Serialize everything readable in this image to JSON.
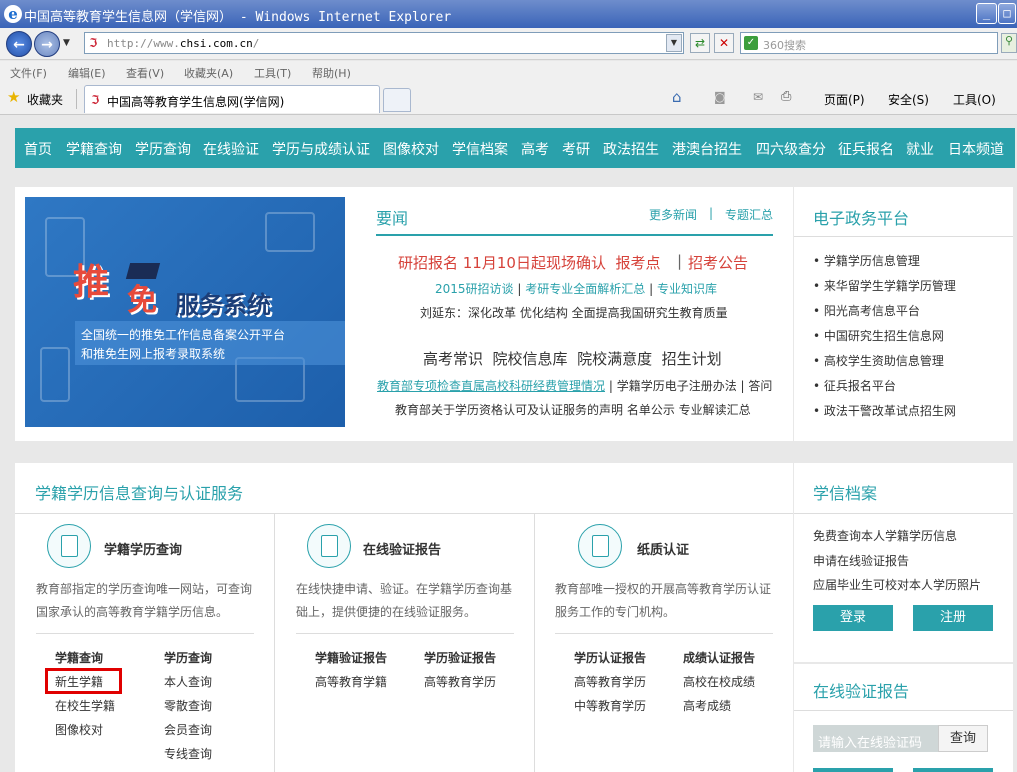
{
  "browser": {
    "title": "中国高等教育学生信息网（学信网） - Windows Internet Explorer",
    "url_prefix": "http://www.",
    "url_domain": "chsi.com.cn",
    "url_suffix": "/",
    "search_placeholder": "360搜索",
    "menu": [
      "文件(F)",
      "编辑(E)",
      "查看(V)",
      "收藏夹(A)",
      "工具(T)",
      "帮助(H)"
    ],
    "favorites_label": "收藏夹",
    "tab_title": "中国高等教育学生信息网(学信网)",
    "cmd_page": "页面(P)",
    "cmd_safety": "安全(S)",
    "cmd_tools": "工具(O)"
  },
  "nav": [
    "首页",
    "学籍查询",
    "学历查询",
    "在线验证",
    "学历与成绩认证",
    "图像校对",
    "学信档案",
    "高考",
    "考研",
    "政法招生",
    "港澳台招生",
    "四六级查分",
    "征兵报名",
    "就业",
    "日本频道"
  ],
  "banner": {
    "title_a": "推",
    "title_b": "免",
    "title_c": "服务系统",
    "line1": "全国统一的推免工作信息备案公开平台",
    "line2": "和推免生网上报考录取系统"
  },
  "news": {
    "title": "要闻",
    "more": "更多新闻",
    "sep": "|",
    "topics": "专题汇总",
    "headline": "研招报名 11月10日起现场确认  报考点",
    "headline_sep": "|",
    "headline_b": "招考公告",
    "row2": [
      "2015研招访谈",
      "|",
      "考研专业全面解析汇总",
      "|",
      "专业知识库"
    ],
    "row3": "刘延东：深化改革 优化结构 全面提高我国研究生教育质量",
    "big2": "高考常识  院校信息库  院校满意度  招生计划",
    "row5_link": "教育部专项检查直属高校科研经费管理情况",
    "row5_rest": "| 学籍学历电子注册办法 | 答问",
    "row6": "教育部关于学历资格认可及认证服务的声明 名单公示 专业解读汇总"
  },
  "egov": {
    "title": "电子政务平台",
    "items": [
      "学籍学历信息管理",
      "来华留学生学籍学历管理",
      "阳光高考信息平台",
      "中国研究生招生信息网",
      "高校学生资助信息管理",
      "征兵报名平台",
      "政法干警改革试点招生网"
    ]
  },
  "services": {
    "title": "学籍学历信息查询与认证服务",
    "cols": [
      {
        "name": "学籍学历查询",
        "desc1": "教育部指定的学历查询唯一网站，可查询",
        "desc2": "国家承认的高等教育学籍学历信息。",
        "groups": [
          {
            "head": "学籍查询",
            "links": [
              "新生学籍",
              "在校生学籍",
              "图像校对"
            ]
          },
          {
            "head": "学历查询",
            "links": [
              "本人查询",
              "零散查询",
              "会员查询",
              "专线查询"
            ]
          }
        ]
      },
      {
        "name": "在线验证报告",
        "desc1": "在线快捷申请、验证。在学籍学历查询基",
        "desc2": "础上，提供便捷的在线验证服务。",
        "groups": [
          {
            "head": "学籍验证报告",
            "links": [
              "高等教育学籍"
            ]
          },
          {
            "head": "学历验证报告",
            "links": [
              "高等教育学历"
            ]
          }
        ]
      },
      {
        "name": "纸质认证",
        "desc1": "教育部唯一授权的开展高等教育学历认证",
        "desc2": "服务工作的专门机构。",
        "groups": [
          {
            "head": "学历认证报告",
            "links": [
              "高等教育学历",
              "中等教育学历"
            ]
          },
          {
            "head": "成绩认证报告",
            "links": [
              "高校在校成绩",
              "高考成绩"
            ]
          }
        ]
      }
    ]
  },
  "archive": {
    "title": "学信档案",
    "items": [
      "免费查询本人学籍学历信息",
      "申请在线验证报告",
      "应届毕业生可校对本人学历照片"
    ],
    "login": "登录",
    "register": "注册"
  },
  "verify": {
    "title": "在线验证报告",
    "placeholder": "请输入在线验证码",
    "query": "查询"
  },
  "colors": {
    "accent": "#2aa1ab",
    "red": "#d6423a",
    "highlight": "#e00000"
  }
}
